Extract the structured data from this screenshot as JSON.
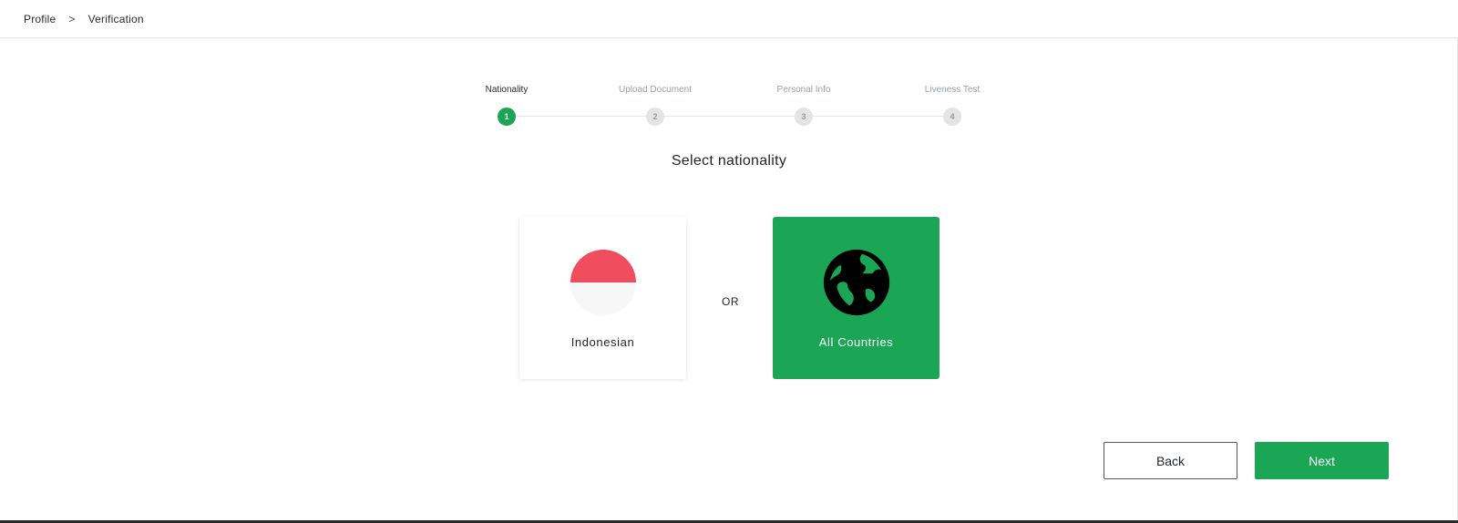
{
  "breadcrumb": {
    "items": [
      "Profile",
      "Verification"
    ],
    "separator": ">"
  },
  "stepper": {
    "steps": [
      {
        "label": "Nationality",
        "number": "1",
        "active": true
      },
      {
        "label": "Upload Document",
        "number": "2",
        "active": false
      },
      {
        "label": "Personal Info",
        "number": "3",
        "active": false
      },
      {
        "label": "Liveness Test",
        "number": "4",
        "active": false
      }
    ]
  },
  "main": {
    "title": "Select nationality",
    "or_text": "OR",
    "options": [
      {
        "label": "Indonesian",
        "icon": "indonesia-flag-icon",
        "selected": false
      },
      {
        "label": "All Countries",
        "icon": "globe-icon",
        "selected": true
      }
    ]
  },
  "actions": {
    "back_label": "Back",
    "next_label": "Next"
  },
  "colors": {
    "accent": "#1aa655",
    "flag_red": "#f04e5e",
    "flag_white": "#f7f7f7",
    "inactive_step": "#e4e4e4"
  }
}
